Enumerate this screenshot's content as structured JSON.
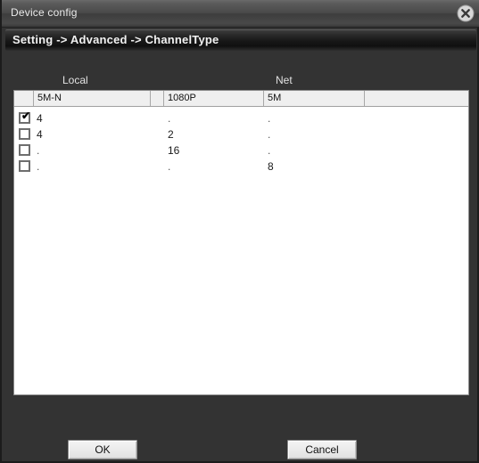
{
  "window": {
    "title": "Device config",
    "close_icon": "close-circle-icon"
  },
  "breadcrumb": {
    "text": "Setting -> Advanced -> ChannelType"
  },
  "group_labels": {
    "local": "Local",
    "net": "Net"
  },
  "table": {
    "headers": [
      "",
      "5M-N",
      "",
      "1080P",
      "5M",
      ""
    ],
    "rows": [
      {
        "checked": true,
        "check_glyph": "✔",
        "cells": [
          "4",
          ".",
          "."
        ]
      },
      {
        "checked": false,
        "check_glyph": "",
        "cells": [
          "4",
          "2",
          "."
        ]
      },
      {
        "checked": false,
        "check_glyph": "",
        "cells": [
          ".",
          "16",
          "."
        ]
      },
      {
        "checked": false,
        "check_glyph": "",
        "cells": [
          ".",
          ".",
          "8"
        ]
      }
    ]
  },
  "buttons": {
    "ok": "OK",
    "cancel": "Cancel"
  },
  "colors": {
    "dialog_bg": "#333333",
    "panel_bg": "#ffffff",
    "header_bg": "#efefef",
    "title_text": "#e9e9e9"
  }
}
